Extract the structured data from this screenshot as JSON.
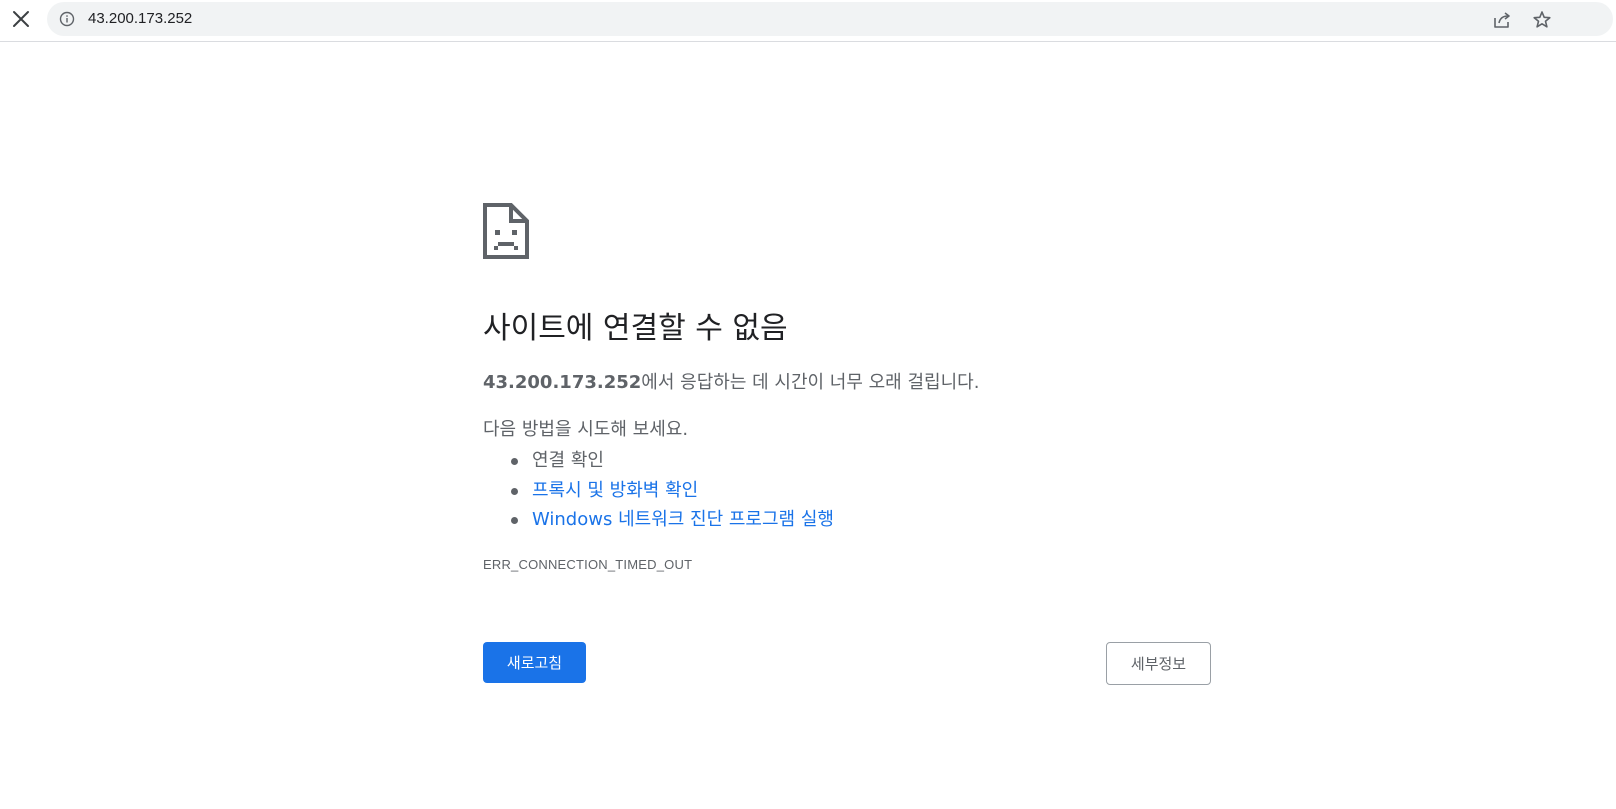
{
  "browser": {
    "url": "43.200.173.252",
    "icons": {
      "close": "close-icon",
      "info": "info-icon",
      "share": "share-icon",
      "bookmark": "star-icon"
    }
  },
  "error_page": {
    "icon": "sad-document-icon",
    "title": "사이트에 연결할 수 없음",
    "summary_host": "43.200.173.252",
    "summary_text": "에서 응답하는 데 시간이 너무 오래 걸립니다.",
    "suggestions_intro": "다음 방법을 시도해 보세요.",
    "suggestions": [
      {
        "label": "연결 확인",
        "is_link": false
      },
      {
        "label": "프록시 및 방화벽 확인",
        "is_link": true
      },
      {
        "label": "Windows 네트워크 진단 프로그램 실행",
        "is_link": true
      }
    ],
    "error_code": "ERR_CONNECTION_TIMED_OUT",
    "reload_label": "새로고침",
    "details_label": "세부정보"
  },
  "colors": {
    "primary_button": "#1a73e8",
    "link": "#1a73e8",
    "secondary_text": "#5f6368"
  }
}
